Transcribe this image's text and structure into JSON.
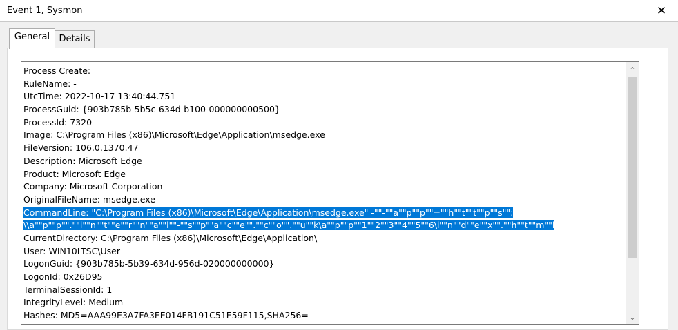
{
  "window": {
    "title": "Event 1, Sysmon",
    "close_glyph": "✕"
  },
  "tabs": [
    {
      "label": "General"
    },
    {
      "label": "Details"
    }
  ],
  "event_text": {
    "lines": [
      "Process Create:",
      "RuleName: -",
      "UtcTime: 2022-10-17 13:40:44.751",
      "ProcessGuid: {903b785b-5b5c-634d-b100-000000000500}",
      "ProcessId: 7320",
      "Image: C:\\Program Files (x86)\\Microsoft\\Edge\\Application\\msedge.exe",
      "FileVersion: 106.0.1370.47",
      "Description: Microsoft Edge",
      "Product: Microsoft Edge",
      "Company: Microsoft Corporation",
      "OriginalFileName: msedge.exe"
    ],
    "highlighted_lines": [
      "CommandLine: \"C:\\Program Files (x86)\\Microsoft\\Edge\\Application\\msedge.exe\" -\"\"-\"\"a\"\"p\"\"p\"\"=\"\"h\"\"t\"\"t\"\"p\"\"s\"\":",
      "\\\\a\"\"p\"\"p\"\".\"\"i\"\"n\"\"t\"\"e\"\"r\"\"n\"\"a\"\"l\"\"-\"\"s\"\"p\"\"a\"\"c\"\"e\"\".\"\"c\"\"o\"\".\"\"u\"\"k\\a\"\"p\"\"p\"\"1\"\"2\"\"3\"\"4\"\"5\"\"6\\i\"\"n\"\"d\"\"e\"\"x\"\".\"\"h\"\"t\"\"m\"\"l"
    ],
    "lines_after": [
      "CurrentDirectory: C:\\Program Files (x86)\\Microsoft\\Edge\\Application\\",
      "User: WIN10LTSC\\User",
      "LogonGuid: {903b785b-5b39-634d-956d-020000000000}",
      "LogonId: 0x26D95",
      "TerminalSessionId: 1",
      "IntegrityLevel: Medium",
      "Hashes: MD5=AAA99E3A7FA3EE014FB191C51E59F115,SHA256="
    ]
  },
  "scrollbar": {
    "up_arrow": "⌃",
    "down_arrow": "⌄"
  },
  "colors": {
    "selection": "#0078d7",
    "selection_text": "#ffffff"
  }
}
